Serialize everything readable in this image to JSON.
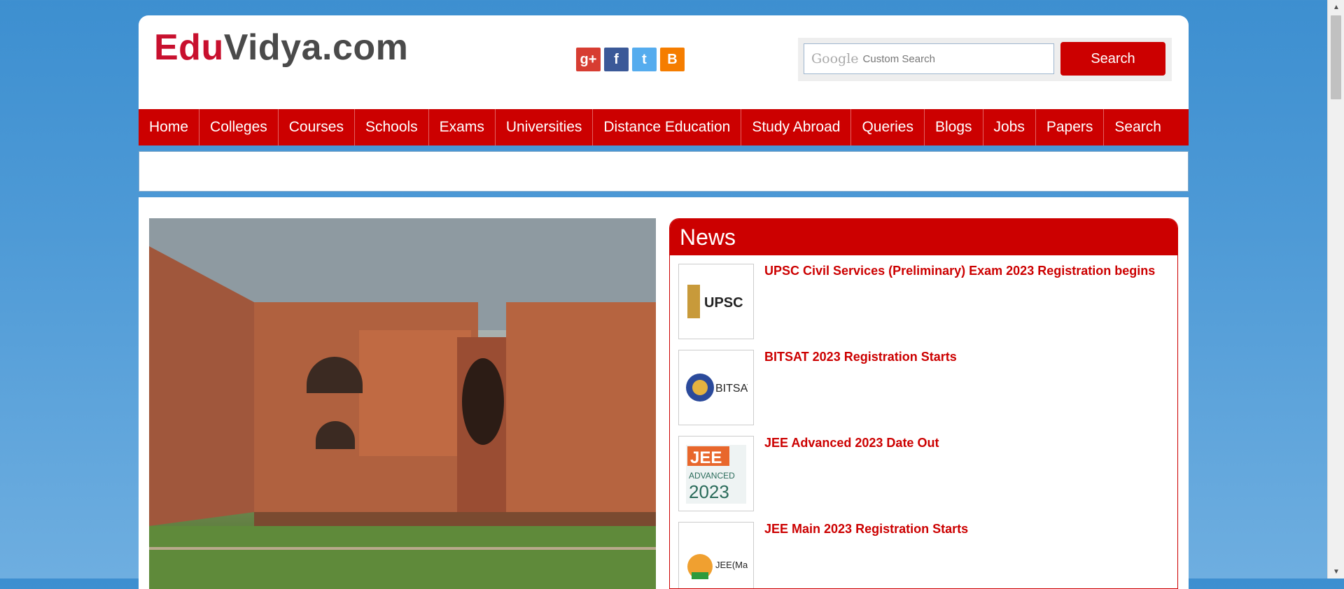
{
  "logo": {
    "part1": "Edu",
    "part2": "Vidya.com"
  },
  "social": {
    "google_plus": "g+",
    "facebook": "f",
    "twitter": "t",
    "blogger": "B"
  },
  "search": {
    "google_brand": "Google",
    "placeholder": "Custom Search",
    "button_label": "Search"
  },
  "nav": {
    "items": [
      "Home",
      "Colleges",
      "Courses",
      "Schools",
      "Exams",
      "Universities",
      "Distance Education",
      "Study Abroad",
      "Queries",
      "Blogs",
      "Jobs",
      "Papers",
      "Search"
    ]
  },
  "news": {
    "heading": "News",
    "items": [
      {
        "title": "UPSC Civil Services (Preliminary) Exam 2023 Registration begins",
        "thumb_label": "UPSC"
      },
      {
        "title": "BITSAT 2023 Registration Starts",
        "thumb_label": "BITSAT"
      },
      {
        "title": "JEE Advanced 2023 Date Out",
        "thumb_label": "JEE",
        "thumb_sub": "ADVANCED",
        "thumb_year": "2023"
      },
      {
        "title": "JEE Main 2023 Registration Starts",
        "thumb_label": "JEE (Main)"
      }
    ]
  },
  "colors": {
    "brand_red": "#cc0000",
    "logo_gray": "#4a4a4a",
    "background_blue": "#4e9ad6"
  }
}
